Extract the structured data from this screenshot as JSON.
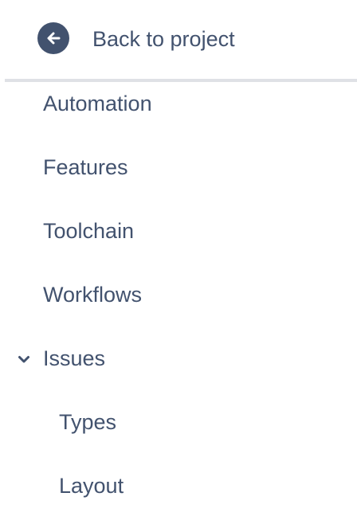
{
  "back": {
    "label": "Back to project",
    "icon": "arrow-left-circle-icon"
  },
  "nav": {
    "items": [
      {
        "label": "Automation"
      },
      {
        "label": "Features"
      },
      {
        "label": "Toolchain"
      },
      {
        "label": "Workflows"
      },
      {
        "label": "Issues",
        "expanded": true,
        "icon": "chevron-down-icon"
      },
      {
        "label": "Types"
      },
      {
        "label": "Layout"
      }
    ]
  },
  "colors": {
    "text": "#42526E",
    "icon_bg": "#42526E",
    "divider": "#DFE1E6",
    "background": "#FFFFFF"
  }
}
